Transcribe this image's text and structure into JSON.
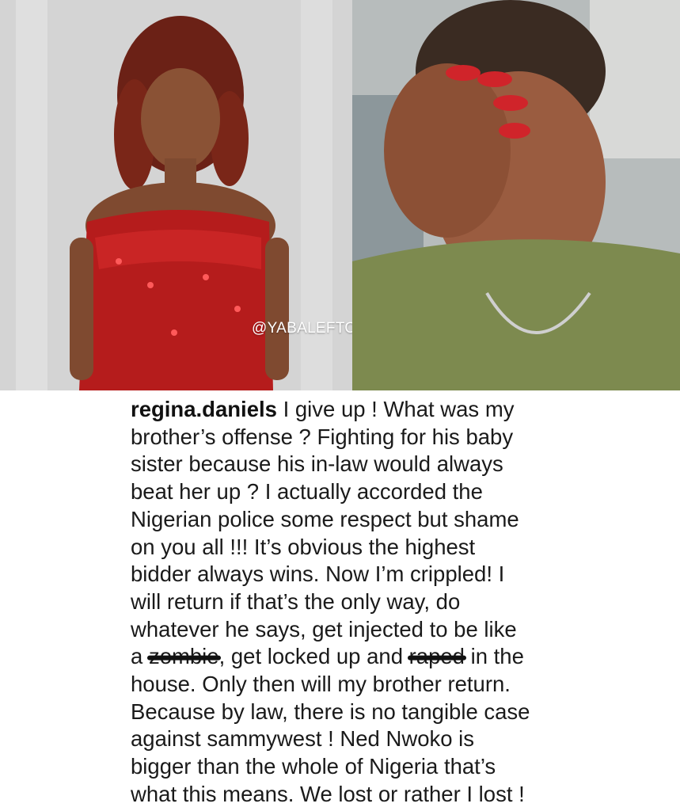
{
  "watermark": "@YABALEFTONLINE",
  "post": {
    "username": "regina.daniels",
    "lines": [
      " I give up ! What was my",
      "brother’s offense ? Fighting for his baby",
      "sister because his in-law would always",
      "beat her up ? I actually accorded the",
      "Nigerian police some respect but shame",
      "on you all !!! It’s obvious the highest",
      "bidder always wins. Now I’m crippled! I",
      "will return if that’s the only way, do",
      "whatever he says, get injected to be like"
    ],
    "line10": {
      "prefix": "a ",
      "scribbled_word_1": "zombie",
      "middle": ", get locked up and ",
      "scribbled_word_2": "raped",
      "suffix": " in the"
    },
    "lines_after": [
      "house. Only then will my brother return.",
      "Because by law, there is no tangible case",
      "against sammywest ! Ned Nwoko is",
      "bigger than the whole of Nigeria that’s",
      "what this means. We lost or rather I lost !"
    ]
  }
}
